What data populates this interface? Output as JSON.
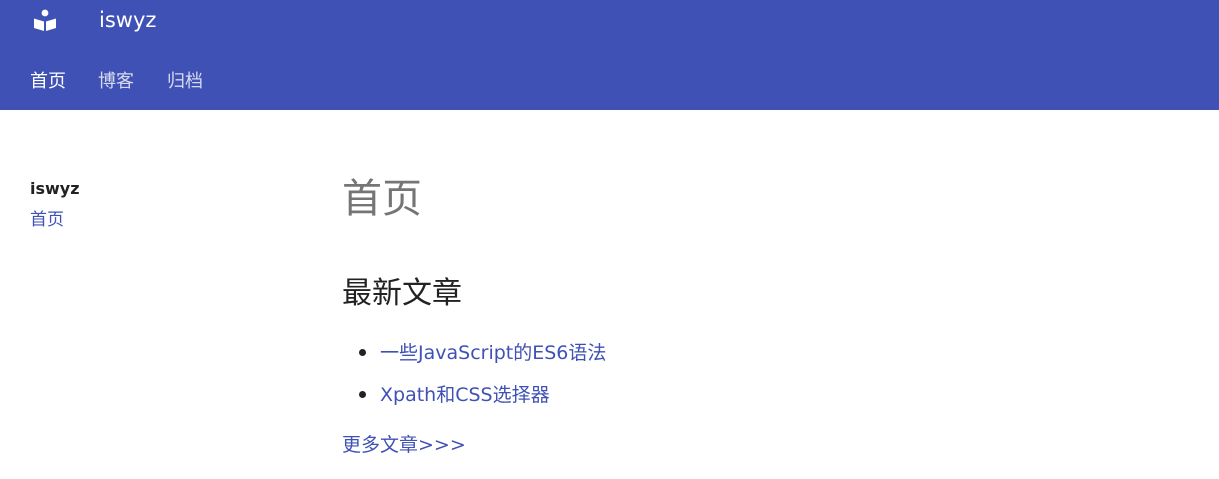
{
  "header": {
    "site_title": "iswyz",
    "logo_icon": "book-reader-icon",
    "background": "#3f51b5"
  },
  "nav": {
    "items": [
      {
        "label": "首页",
        "active": true
      },
      {
        "label": "博客",
        "active": false
      },
      {
        "label": "归档",
        "active": false
      }
    ]
  },
  "sidebar": {
    "title": "iswyz",
    "link": "首页"
  },
  "main": {
    "page_title": "首页",
    "section_title": "最新文章",
    "posts": [
      {
        "title": "一些JavaScript的ES6语法"
      },
      {
        "title": "Xpath和CSS选择器"
      }
    ],
    "more_link": "更多文章>>>"
  },
  "colors": {
    "accent": "#3f51b5",
    "title_gray": "#757575",
    "text": "#222222"
  }
}
